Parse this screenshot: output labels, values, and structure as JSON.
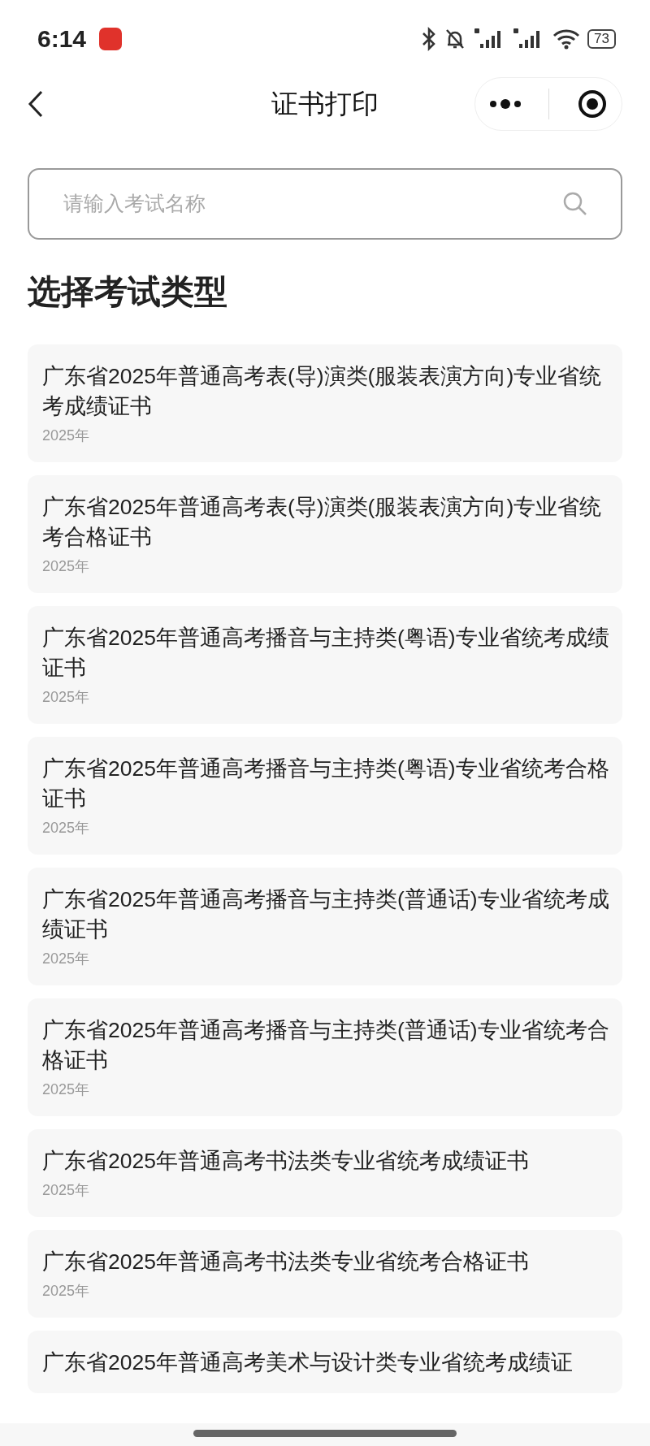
{
  "status_bar": {
    "time": "6:14",
    "battery": "73"
  },
  "header": {
    "title": "证书打印"
  },
  "search": {
    "placeholder": "请输入考试名称"
  },
  "section_title": "选择考试类型",
  "exams": [
    {
      "name": "广东省2025年普通高考表(导)演类(服装表演方向)专业省统考成绩证书",
      "year": "2025年"
    },
    {
      "name": "广东省2025年普通高考表(导)演类(服装表演方向)专业省统考合格证书",
      "year": "2025年"
    },
    {
      "name": "广东省2025年普通高考播音与主持类(粤语)专业省统考成绩证书",
      "year": "2025年"
    },
    {
      "name": "广东省2025年普通高考播音与主持类(粤语)专业省统考合格证书",
      "year": "2025年"
    },
    {
      "name": "广东省2025年普通高考播音与主持类(普通话)专业省统考成绩证书",
      "year": "2025年"
    },
    {
      "name": "广东省2025年普通高考播音与主持类(普通话)专业省统考合格证书",
      "year": "2025年"
    },
    {
      "name": "广东省2025年普通高考书法类专业省统考成绩证书",
      "year": "2025年"
    },
    {
      "name": "广东省2025年普通高考书法类专业省统考合格证书",
      "year": "2025年"
    },
    {
      "name": "广东省2025年普通高考美术与设计类专业省统考成绩证"
    }
  ]
}
